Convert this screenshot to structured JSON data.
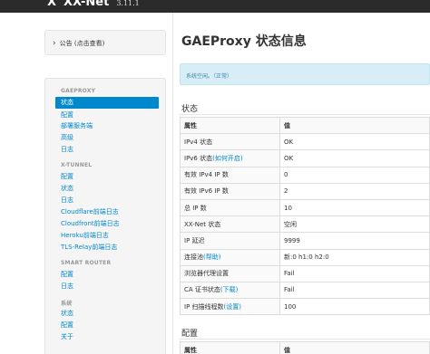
{
  "brand": {
    "logo": "X",
    "name": "XX-Net",
    "version": "3.11.1"
  },
  "notice": {
    "arrow": "›",
    "label": "公告 (点击查看)"
  },
  "sidebar": {
    "sections": [
      {
        "header": "GAEPROXY",
        "items": [
          {
            "label": "状态",
            "active": true
          },
          {
            "label": "配置"
          },
          {
            "label": "部署服务端"
          },
          {
            "label": "高级"
          },
          {
            "label": "日志"
          }
        ]
      },
      {
        "header": "X-TUNNEL",
        "items": [
          {
            "label": "配置"
          },
          {
            "label": "状态"
          },
          {
            "label": "日志"
          },
          {
            "label": "Cloudflare前端日志"
          },
          {
            "label": "Cloudfront前端日志"
          },
          {
            "label": "Heroku前端日志"
          },
          {
            "label": "TLS-Relay前端日志"
          }
        ]
      },
      {
        "header": "SMART ROUTER",
        "items": [
          {
            "label": "配置"
          },
          {
            "label": "日志"
          }
        ]
      },
      {
        "header": "系统",
        "items": [
          {
            "label": "状态"
          },
          {
            "label": "配置"
          },
          {
            "label": "关于"
          }
        ]
      }
    ]
  },
  "main": {
    "title": "GAEProxy 状态信息",
    "alert": "系统空闲。（正常）",
    "status_section": {
      "title": "状态",
      "headers": [
        "属性",
        "值"
      ],
      "rows": [
        {
          "key": "IPv4 状态",
          "value": "OK"
        },
        {
          "key": "IPv6 状态",
          "key_link": "(如何开启)",
          "value": "OK"
        },
        {
          "key": "有效 IPv4 IP 数",
          "value": "0"
        },
        {
          "key": "有效 IPv6 IP 数",
          "value": "2"
        },
        {
          "key": "总 IP 数",
          "value": "10"
        },
        {
          "key": "XX-Net 状态",
          "value": "空闲"
        },
        {
          "key": "IP 延迟",
          "value": "9999"
        },
        {
          "key": "连接池",
          "key_link": "(帮助)",
          "value": "新:0 h1:0 h2:0"
        },
        {
          "key": "浏览器代理设置",
          "value": "Fail"
        },
        {
          "key": "CA 证书状态",
          "key_link": "(下载)",
          "value": "Fail"
        },
        {
          "key": "IP 扫描线程数",
          "key_link": "(设置)",
          "value": "100"
        }
      ]
    },
    "config_section": {
      "title": "配置",
      "headers": [
        "属性",
        "值"
      ]
    }
  },
  "colors": {
    "topbar": "#2b2b2b",
    "link": "#0088cc",
    "active_bg": "#0088cc",
    "alert_bg": "#d9edf7",
    "alert_text": "#3a87ad"
  }
}
